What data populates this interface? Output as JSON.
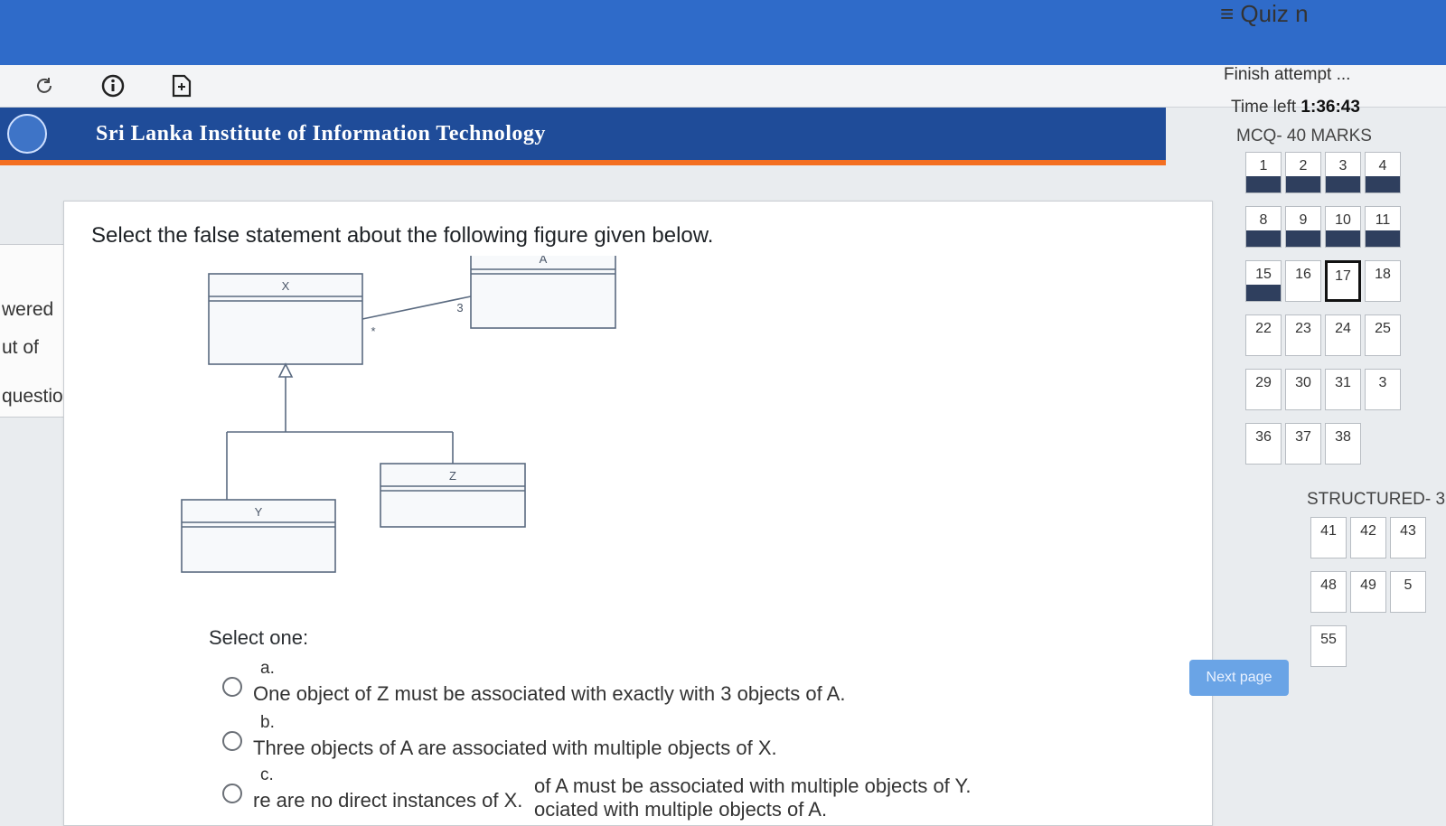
{
  "window": {
    "close_glyph": "×"
  },
  "toolbar": {
    "reload_icon": "reload-icon",
    "info_icon": "info-icon",
    "page_icon": "page-icon"
  },
  "banner": {
    "institute": "Sri Lanka Institute of Information Technology"
  },
  "left_panel": {
    "line1": "wered",
    "line2": "ut of",
    "line3": "question"
  },
  "question": {
    "prompt": "Select the false statement about the following figure given below.",
    "select_one": "Select one:",
    "options": [
      {
        "letter": "a.",
        "text": "One object of Z must be associated with exactly with 3 objects of  A."
      },
      {
        "letter": "b.",
        "text": "Three objects of A are associated with multiple objects of X."
      },
      {
        "letter": "c.",
        "text": "re are no direct instances of X."
      },
      {
        "letter": "",
        "text": "of A must be associated with multiple objects of Y."
      },
      {
        "letter": "",
        "text": "ociated with multiple objects of A."
      }
    ]
  },
  "diagram": {
    "classes": {
      "x": "X",
      "a": "A",
      "y": "Y",
      "z": "Z"
    },
    "mult_x": "*",
    "mult_a": "3"
  },
  "navigation": {
    "title": "Quiz n",
    "menu_icon": "menu-icon",
    "finish": "Finish attempt ...",
    "time_label": "Time left",
    "time_value": "1:36:43",
    "mcq_label": "MCQ- 40 MARKS",
    "mcq_buttons": [
      {
        "n": "1",
        "state": "answered"
      },
      {
        "n": "2",
        "state": "answered"
      },
      {
        "n": "3",
        "state": "answered"
      },
      {
        "n": "4",
        "state": "answered"
      },
      {
        "n": "8",
        "state": "answered"
      },
      {
        "n": "9",
        "state": "answered"
      },
      {
        "n": "10",
        "state": "answered"
      },
      {
        "n": "11",
        "state": "answered"
      },
      {
        "n": "15",
        "state": "answered"
      },
      {
        "n": "16",
        "state": "unanswered"
      },
      {
        "n": "17",
        "state": "current"
      },
      {
        "n": "18",
        "state": "unanswered"
      },
      {
        "n": "22",
        "state": "unanswered"
      },
      {
        "n": "23",
        "state": "unanswered"
      },
      {
        "n": "24",
        "state": "unanswered"
      },
      {
        "n": "25",
        "state": "unanswered"
      },
      {
        "n": "29",
        "state": "unanswered"
      },
      {
        "n": "30",
        "state": "unanswered"
      },
      {
        "n": "31",
        "state": "unanswered"
      },
      {
        "n": "3",
        "state": "unanswered"
      },
      {
        "n": "36",
        "state": "unanswered"
      },
      {
        "n": "37",
        "state": "unanswered"
      },
      {
        "n": "38",
        "state": "unanswered"
      }
    ],
    "structured_label": "STRUCTURED- 3",
    "structured_buttons": [
      {
        "n": "41",
        "state": "unanswered"
      },
      {
        "n": "42",
        "state": "unanswered"
      },
      {
        "n": "43",
        "state": "unanswered"
      },
      {
        "n": "48",
        "state": "unanswered"
      },
      {
        "n": "49",
        "state": "unanswered"
      },
      {
        "n": "5",
        "state": "unanswered"
      },
      {
        "n": "55",
        "state": "unanswered"
      }
    ],
    "next_page": "Next page"
  },
  "colors": {
    "topbar": "#2f6bc9",
    "banner": "#1f4c99",
    "accent": "#f36f21",
    "answered": "#2f3f5e",
    "button": "#6aa4e6"
  }
}
